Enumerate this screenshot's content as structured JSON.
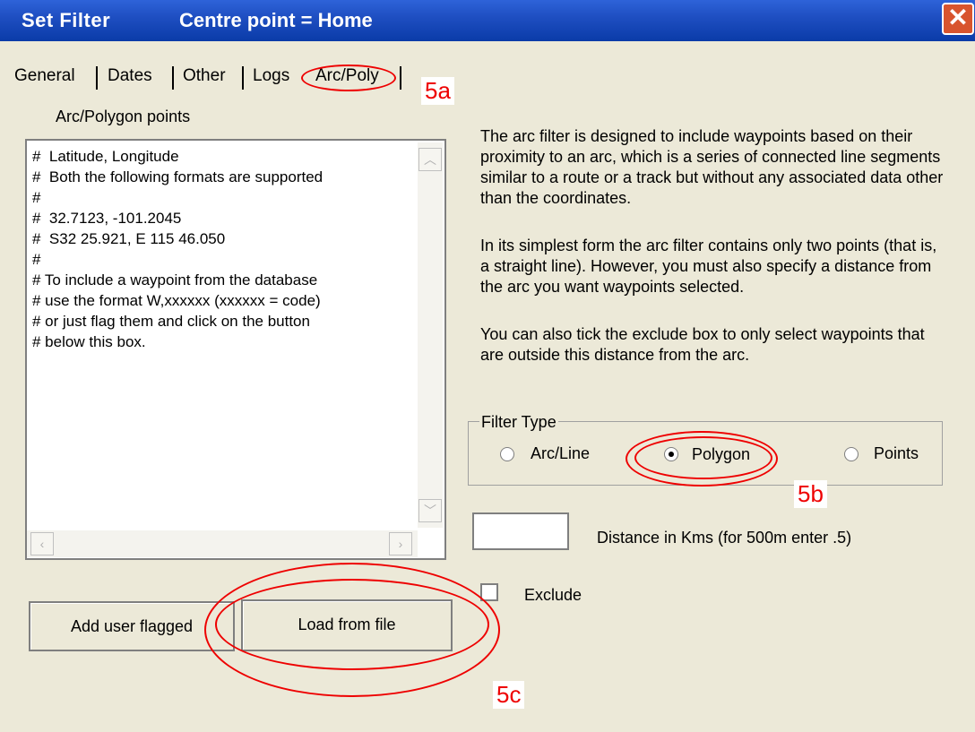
{
  "titlebar": {
    "title": "Set Filter",
    "subtitle": "Centre point = Home",
    "close_icon": "close-icon"
  },
  "tabs": [
    {
      "label": "General"
    },
    {
      "label": "Dates"
    },
    {
      "label": "Other"
    },
    {
      "label": "Logs"
    },
    {
      "label": "Arc/Poly"
    }
  ],
  "annotations": {
    "a": "5a",
    "b": "5b",
    "c": "5c"
  },
  "points_section": {
    "label": "Arc/Polygon points",
    "lines": [
      "#  Latitude, Longitude",
      "#  Both the following formats are supported",
      "#",
      "#  32.7123, -101.2045",
      "#  S32 25.921, E 115 46.050",
      "#",
      "# To include a waypoint from the database",
      "# use the format W,xxxxxx (xxxxxx = code)",
      "# or just flag them and click on the button",
      "# below this box."
    ]
  },
  "description": {
    "p1": "The arc filter is designed to include waypoints based on their proximity to an arc, which is a series of connected line segments similar to a route or a track but without any associated data other than the coordinates.",
    "p2": "In its simplest form the arc filter contains only two points (that is, a straight line). However, you must also specify a distance from the arc you want waypoints selected.",
    "p3": "You can also tick the exclude box to only select waypoints that are outside this distance from the arc."
  },
  "filter_type": {
    "legend": "Filter Type",
    "options": [
      {
        "label": "Arc/Line",
        "checked": false
      },
      {
        "label": "Polygon",
        "checked": true
      },
      {
        "label": "Points",
        "checked": false
      }
    ]
  },
  "distance": {
    "value": "",
    "label": "Distance in Kms (for 500m enter .5)"
  },
  "exclude": {
    "label": "Exclude",
    "checked": false
  },
  "buttons": {
    "add_flagged": "Add user flagged",
    "load_file": "Load from file"
  },
  "colors": {
    "titlebar": "#0a3ba8",
    "dialog": "#ece9d8",
    "annotation": "#e00000"
  }
}
